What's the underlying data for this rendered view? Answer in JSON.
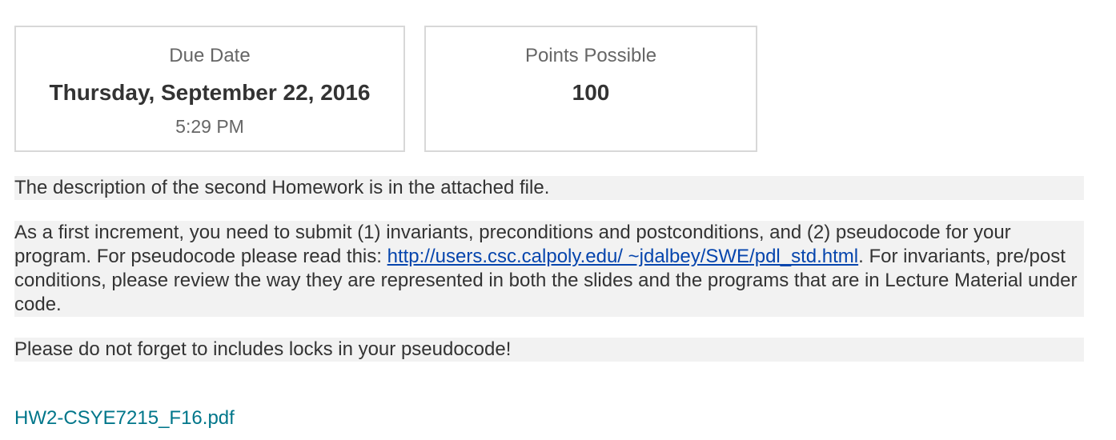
{
  "due": {
    "label": "Due Date",
    "date": "Thursday, September 22, 2016",
    "time": "5:29 PM"
  },
  "points": {
    "label": "Points Possible",
    "value": "100"
  },
  "description": {
    "p1": "The description of the second Homework is in the attached file.",
    "p2_before": "As a first increment, you need to submit (1) invariants, preconditions and postconditions, and (2) pseudocode for your program. For pseudocode please read this: ",
    "p2_link": "http://users.csc.calpoly.edu/ ~jdalbey/SWE/pdl_std.html",
    "p2_after": ". For invariants, pre/post conditions, please review the way they are represented in both the slides and the programs that are in Lecture Material under code.",
    "p3": "Please do not forget to includes locks in your pseudocode!"
  },
  "attachment": {
    "filename": "HW2-CSYE7215_F16.pdf"
  }
}
